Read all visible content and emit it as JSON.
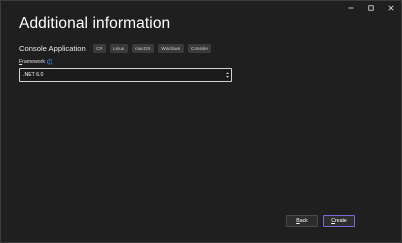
{
  "window": {
    "controls": [
      "minimize-icon",
      "maximize-icon",
      "close-icon"
    ]
  },
  "header": {
    "title": "Additional information",
    "project_name": "Console Application",
    "tags": [
      "C#",
      "Linux",
      "macOS",
      "Windows",
      "Console"
    ]
  },
  "form": {
    "framework_label_accesskey": "F",
    "framework_label_rest": "ramework",
    "info_icon": "info-icon",
    "framework_value": ".NET 6.0"
  },
  "footer": {
    "back_accesskey": "B",
    "back_rest": "ack",
    "create_accesskey": "C",
    "create_rest": "reate"
  },
  "colors": {
    "background": "#1f1f1f",
    "accent_border": "#7a6ad8",
    "info_icon": "#3794ff"
  }
}
